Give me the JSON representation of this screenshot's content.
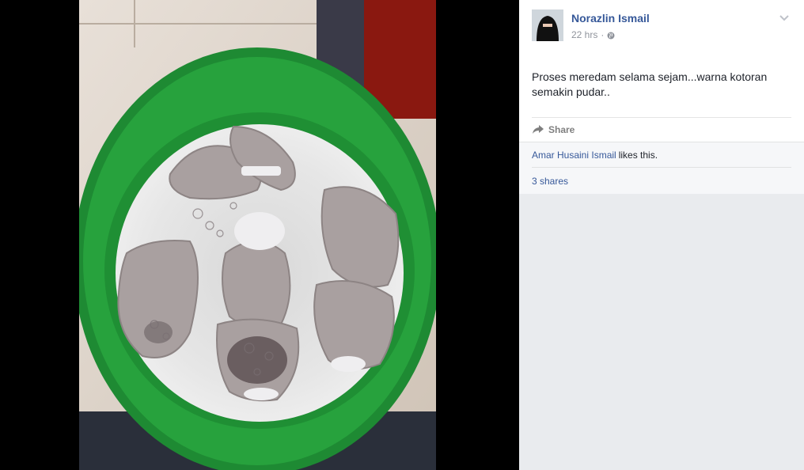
{
  "post": {
    "author_name": "Norazlin Ismail",
    "timestamp": "22 hrs",
    "separator": "·",
    "message": "Proses meredam selama sejam...warna kotoran semakin pudar..",
    "share_label": "Share"
  },
  "social": {
    "liker_name": "Amar Husaini Ismail",
    "likes_suffix": "likes this.",
    "shares_label": "3 shares"
  },
  "colors": {
    "link": "#365899",
    "panel_bg": "#e9ebee",
    "basin_green": "#239b3a"
  },
  "icons": [
    "globe-icon",
    "chevron-down-icon",
    "share-arrow-icon"
  ]
}
